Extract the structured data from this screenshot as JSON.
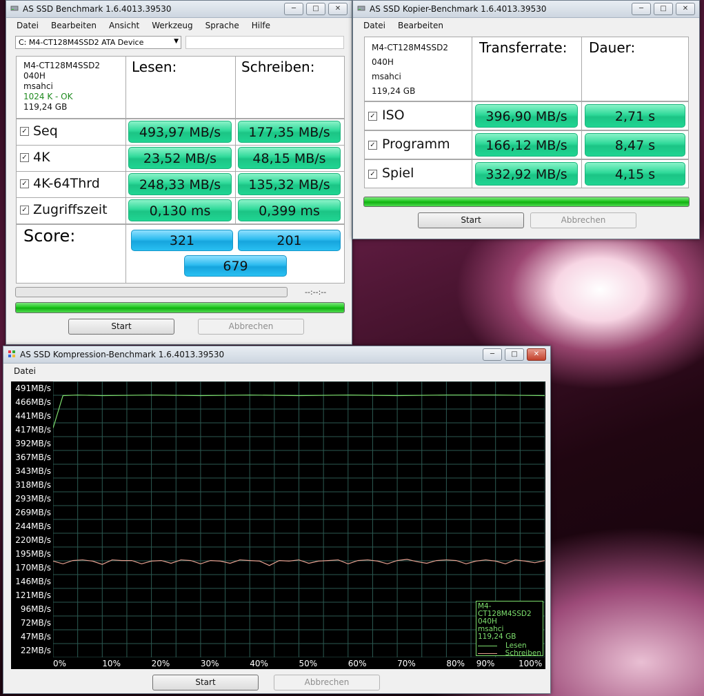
{
  "main_window": {
    "title": "AS SSD Benchmark 1.6.4013.39530",
    "menu": [
      "Datei",
      "Bearbeiten",
      "Ansicht",
      "Werkzeug",
      "Sprache",
      "Hilfe"
    ],
    "drive_select": "C: M4-CT128M4SSD2 ATA Device",
    "drive_info": {
      "model": "M4-CT128M4SSD2",
      "firmware": "040H",
      "driver": "msahci",
      "alignment": "1024 K - OK",
      "capacity": "119,24 GB"
    },
    "col_read": "Lesen:",
    "col_write": "Schreiben:",
    "rows": [
      {
        "label": "Seq",
        "read": "493,97 MB/s",
        "write": "177,35 MB/s"
      },
      {
        "label": "4K",
        "read": "23,52 MB/s",
        "write": "48,15 MB/s"
      },
      {
        "label": "4K-64Thrd",
        "read": "248,33 MB/s",
        "write": "135,32 MB/s"
      },
      {
        "label": "Zugriffszeit",
        "read": "0,130 ms",
        "write": "0,399 ms"
      }
    ],
    "score_label": "Score:",
    "score_read": "321",
    "score_write": "201",
    "score_total": "679",
    "time_readout": "--:--:--",
    "start": "Start",
    "cancel": "Abbrechen"
  },
  "copy_window": {
    "title": "AS SSD Kopier-Benchmark 1.6.4013.39530",
    "menu": [
      "Datei",
      "Bearbeiten"
    ],
    "drive_info": {
      "model": "M4-CT128M4SSD2",
      "firmware": "040H",
      "driver": "msahci",
      "capacity": "119,24 GB"
    },
    "col_rate": "Transferrate:",
    "col_time": "Dauer:",
    "rows": [
      {
        "label": "ISO",
        "rate": "396,90 MB/s",
        "time": "2,71 s"
      },
      {
        "label": "Programm",
        "rate": "166,12 MB/s",
        "time": "8,47 s"
      },
      {
        "label": "Spiel",
        "rate": "332,92 MB/s",
        "time": "4,15 s"
      }
    ],
    "start": "Start",
    "cancel": "Abbrechen"
  },
  "compress_window": {
    "title": "AS SSD Kompression-Benchmark 1.6.4013.39530",
    "menu": [
      "Datei"
    ],
    "start": "Start",
    "cancel": "Abbrechen",
    "legend": {
      "model": "M4-CT128M4SSD2",
      "firmware": "040H",
      "driver": "msahci",
      "capacity": "119,24 GB",
      "read": "Lesen",
      "write": "Schreiben"
    }
  },
  "chart_data": {
    "type": "line",
    "x_ticks": [
      "0%",
      "10%",
      "20%",
      "30%",
      "40%",
      "50%",
      "60%",
      "70%",
      "80%",
      "90%",
      "100%"
    ],
    "y_ticks": [
      "491MB/s",
      "466MB/s",
      "441MB/s",
      "417MB/s",
      "392MB/s",
      "367MB/s",
      "343MB/s",
      "318MB/s",
      "293MB/s",
      "269MB/s",
      "244MB/s",
      "220MB/s",
      "195MB/s",
      "170MB/s",
      "146MB/s",
      "121MB/s",
      "96MB/s",
      "72MB/s",
      "47MB/s",
      "22MB/s"
    ],
    "ylim": [
      22,
      491
    ],
    "xlim": [
      0,
      100
    ],
    "series": [
      {
        "name": "Lesen",
        "color": "#7ee06e",
        "x": [
          0,
          2,
          5,
          10,
          20,
          30,
          40,
          50,
          60,
          70,
          80,
          90,
          100
        ],
        "y": [
          420,
          478,
          479,
          478,
          479,
          478,
          479,
          478,
          479,
          478,
          479,
          479,
          478
        ]
      },
      {
        "name": "Schreiben",
        "color": "#e6a090",
        "x": [
          0,
          2,
          4,
          6,
          8,
          10,
          12,
          14,
          16,
          18,
          20,
          22,
          24,
          26,
          28,
          30,
          32,
          34,
          36,
          38,
          40,
          42,
          44,
          46,
          48,
          50,
          52,
          54,
          56,
          58,
          60,
          62,
          64,
          66,
          68,
          70,
          72,
          74,
          76,
          78,
          80,
          82,
          84,
          86,
          88,
          90,
          92,
          94,
          96,
          98,
          100
        ],
        "y": [
          182,
          177,
          183,
          184,
          182,
          176,
          184,
          183,
          183,
          177,
          182,
          183,
          178,
          184,
          183,
          177,
          183,
          182,
          178,
          184,
          183,
          182,
          174,
          183,
          182,
          184,
          178,
          182,
          183,
          184,
          177,
          183,
          184,
          182,
          177,
          183,
          185,
          181,
          178,
          183,
          184,
          183,
          177,
          182,
          184,
          182,
          177,
          184,
          182,
          179,
          183
        ]
      }
    ],
    "grid": true,
    "legend_position": "bottom-right"
  }
}
